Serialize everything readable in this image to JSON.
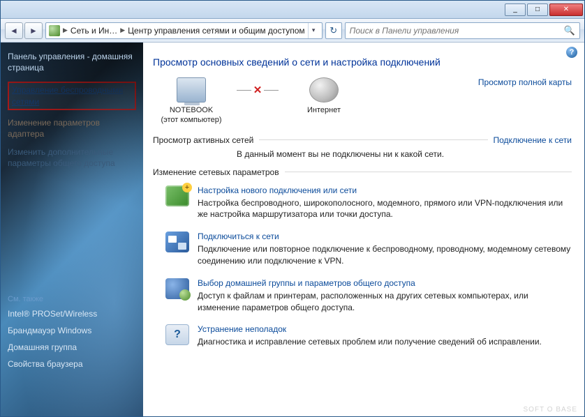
{
  "titlebar": {
    "min": "_",
    "max": "□",
    "close": "✕"
  },
  "nav": {
    "back": "◄",
    "forward": "►",
    "seg1": "Сеть и Ин…",
    "seg2": "Центр управления сетями и общим доступом",
    "refresh": "↻",
    "search_placeholder": "Поиск в Панели управления",
    "mag": "🔍"
  },
  "sidebar": {
    "home": "Панель управления - домашняя страница",
    "wireless": "Управление беспроводными сетями",
    "adapter": "Изменение параметров адаптера",
    "advanced": "Изменить дополнительные параметры общего доступа",
    "also_hdr": "См. также",
    "also": [
      "Intel® PROSet/Wireless",
      "Брандмауэр Windows",
      "Домашняя группа",
      "Свойства браузера"
    ]
  },
  "content": {
    "help": "?",
    "heading": "Просмотр основных сведений о сети и настройка подключений",
    "node_pc": "NOTEBOOK",
    "node_pc_sub": "(этот компьютер)",
    "node_net": "Интернет",
    "conn_x": "✕",
    "fullmap": "Просмотр полной карты",
    "active_hdr": "Просмотр активных сетей",
    "connect_link": "Подключение к сети",
    "active_msg": "В данный момент вы не подключены ни к какой сети.",
    "change_hdr": "Изменение сетевых параметров",
    "tasks": [
      {
        "title": "Настройка нового подключения или сети",
        "desc": "Настройка беспроводного, широкополосного, модемного, прямого или VPN-подключения или же настройка маршрутизатора или точки доступа."
      },
      {
        "title": "Подключиться к сети",
        "desc": "Подключение или повторное подключение к беспроводному, проводному, модемному сетевому соединению или подключение к VPN."
      },
      {
        "title": "Выбор домашней группы и параметров общего доступа",
        "desc": "Доступ к файлам и принтерам, расположенных на других сетевых компьютерах, или изменение параметров общего доступа."
      },
      {
        "title": "Устранение неполадок",
        "desc": "Диагностика и исправление сетевых проблем или получение сведений об исправлении."
      }
    ]
  },
  "watermark": "SOFT O BASE"
}
